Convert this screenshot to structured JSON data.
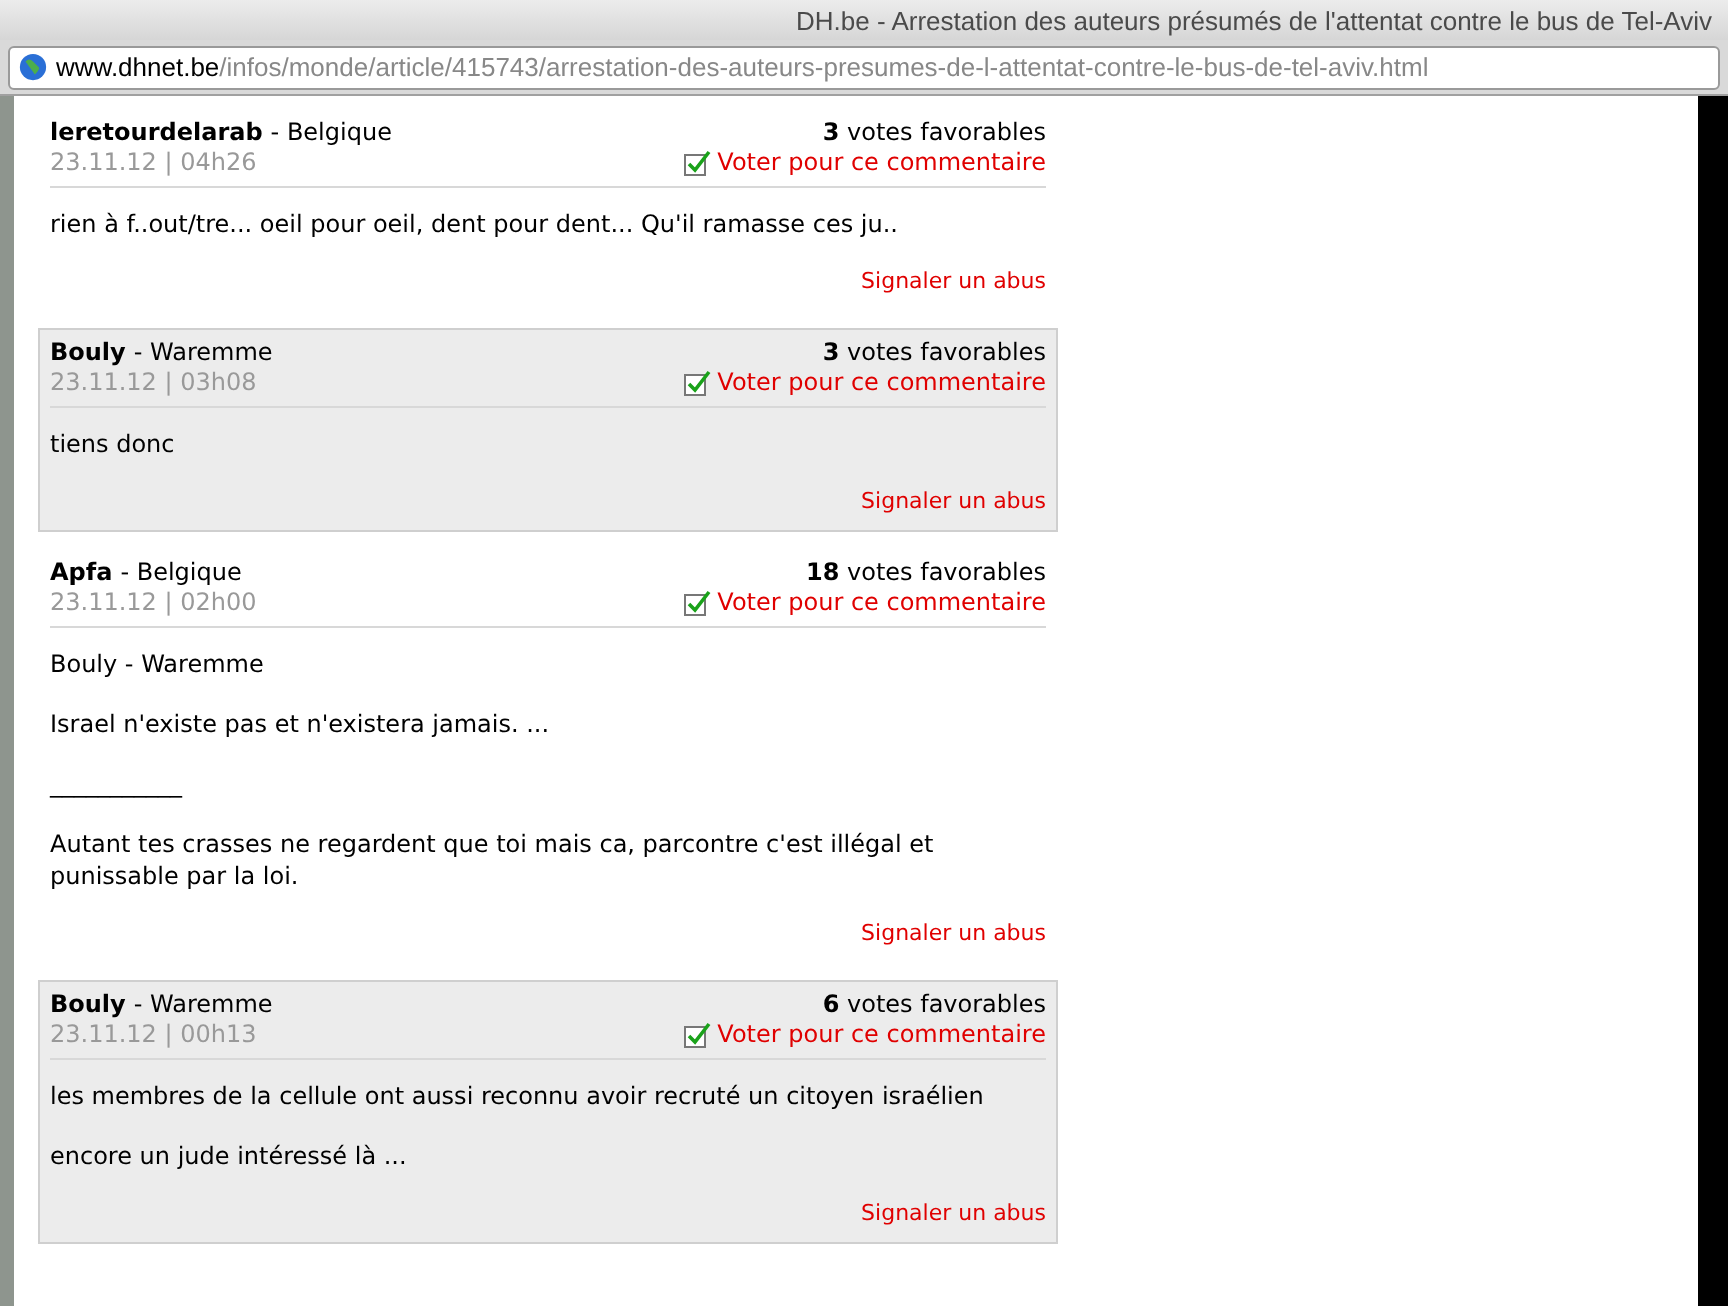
{
  "window": {
    "title": "DH.be - Arrestation des auteurs présumés de l'attentat contre le bus de Tel-Aviv"
  },
  "address_bar": {
    "domain": "www.dhnet.be",
    "path": "/infos/monde/article/415743/arrestation-des-auteurs-presumes-de-l-attentat-contre-le-bus-de-tel-aviv.html"
  },
  "comments": [
    {
      "author": "leretourdelarab",
      "location": "- Belgique",
      "date": "23.11.12 | 04h26",
      "votes": "3",
      "votes_label": "votes favorables",
      "vote_link": "Voter pour ce commentaire",
      "highlighted": false,
      "paragraphs": [
        "rien à f..out/tre... oeil pour oeil, dent pour dent... Qu'il ramasse ces ju.."
      ],
      "report_link": "Signaler un abus"
    },
    {
      "author": "Bouly",
      "location": "- Waremme",
      "date": "23.11.12 | 03h08",
      "votes": "3",
      "votes_label": "votes favorables",
      "vote_link": "Voter pour ce commentaire",
      "highlighted": true,
      "paragraphs": [
        "tiens donc"
      ],
      "report_link": "Signaler un abus"
    },
    {
      "author": "Apfa",
      "location": "- Belgique",
      "date": "23.11.12 | 02h00",
      "votes": "18",
      "votes_label": "votes favorables",
      "vote_link": "Voter pour ce commentaire",
      "highlighted": false,
      "paragraphs": [
        "Bouly - Waremme",
        "Israel n'existe pas et n'existera jamais. ...",
        "___________",
        "Autant tes crasses ne regardent que toi mais ca, parcontre c'est illégal et punissable par la loi."
      ],
      "report_link": "Signaler un abus"
    },
    {
      "author": "Bouly",
      "location": "- Waremme",
      "date": "23.11.12 | 00h13",
      "votes": "6",
      "votes_label": "votes favorables",
      "vote_link": "Voter pour ce commentaire",
      "highlighted": true,
      "paragraphs": [
        "les membres de la cellule ont aussi reconnu avoir recruté un citoyen israélien",
        "encore un jude intéressé là ..."
      ],
      "report_link": "Signaler un abus"
    }
  ]
}
